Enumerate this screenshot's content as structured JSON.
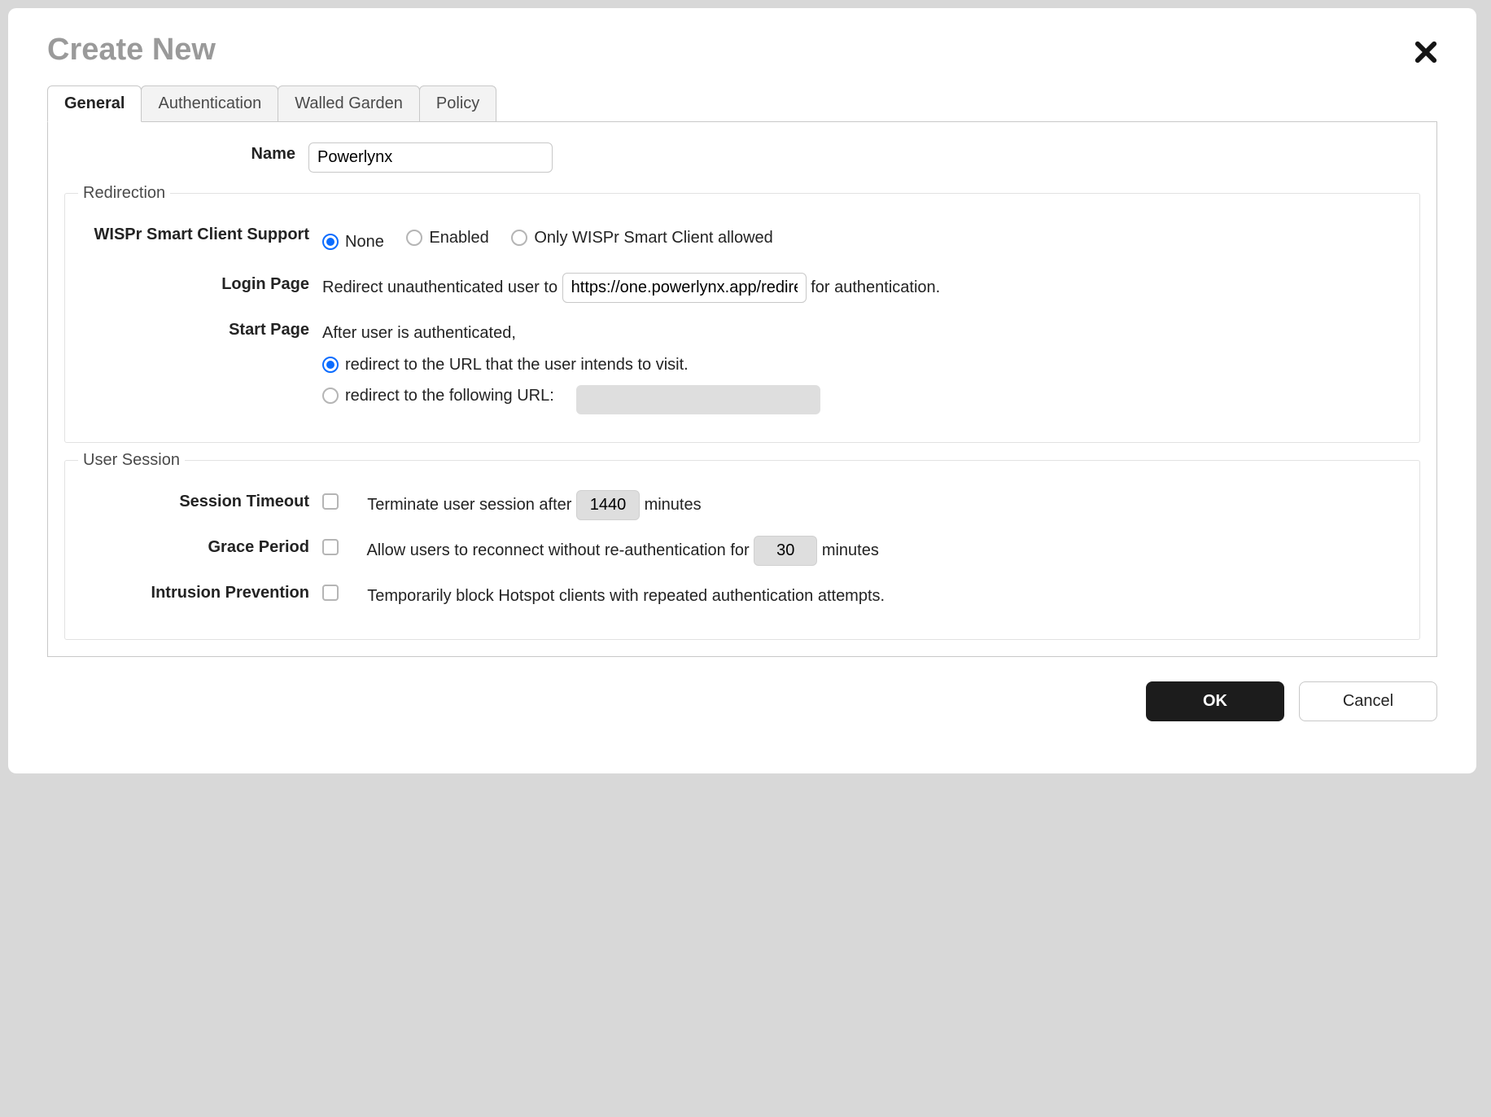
{
  "modal": {
    "title": "Create New"
  },
  "tabs": [
    "General",
    "Authentication",
    "Walled Garden",
    "Policy"
  ],
  "activeTab": 0,
  "general": {
    "name": {
      "label": "Name",
      "value": "Powerlynx"
    },
    "redirection": {
      "legend": "Redirection",
      "wispr": {
        "label": "WISPr Smart Client Support",
        "options": [
          "None",
          "Enabled",
          "Only WISPr Smart Client allowed"
        ],
        "selected": 0
      },
      "loginPage": {
        "label": "Login Page",
        "before": "Redirect unauthenticated user to",
        "url": "https://one.powerlynx.app/redire",
        "after": "for authentication."
      },
      "startPage": {
        "label": "Start Page",
        "intro": "After user is authenticated,",
        "opt1": "redirect to the URL that the user intends to visit.",
        "opt2": "redirect to the following URL:",
        "selected": 0,
        "customUrl": ""
      }
    },
    "userSession": {
      "legend": "User Session",
      "sessionTimeout": {
        "label": "Session Timeout",
        "checked": false,
        "before": "Terminate user session after",
        "value": "1440",
        "after": "minutes"
      },
      "gracePeriod": {
        "label": "Grace Period",
        "checked": false,
        "before": "Allow users to reconnect without re-authentication for",
        "value": "30",
        "after": "minutes"
      },
      "intrusion": {
        "label": "Intrusion Prevention",
        "checked": false,
        "text": "Temporarily block Hotspot clients with repeated authentication attempts."
      }
    }
  },
  "buttons": {
    "ok": "OK",
    "cancel": "Cancel"
  }
}
